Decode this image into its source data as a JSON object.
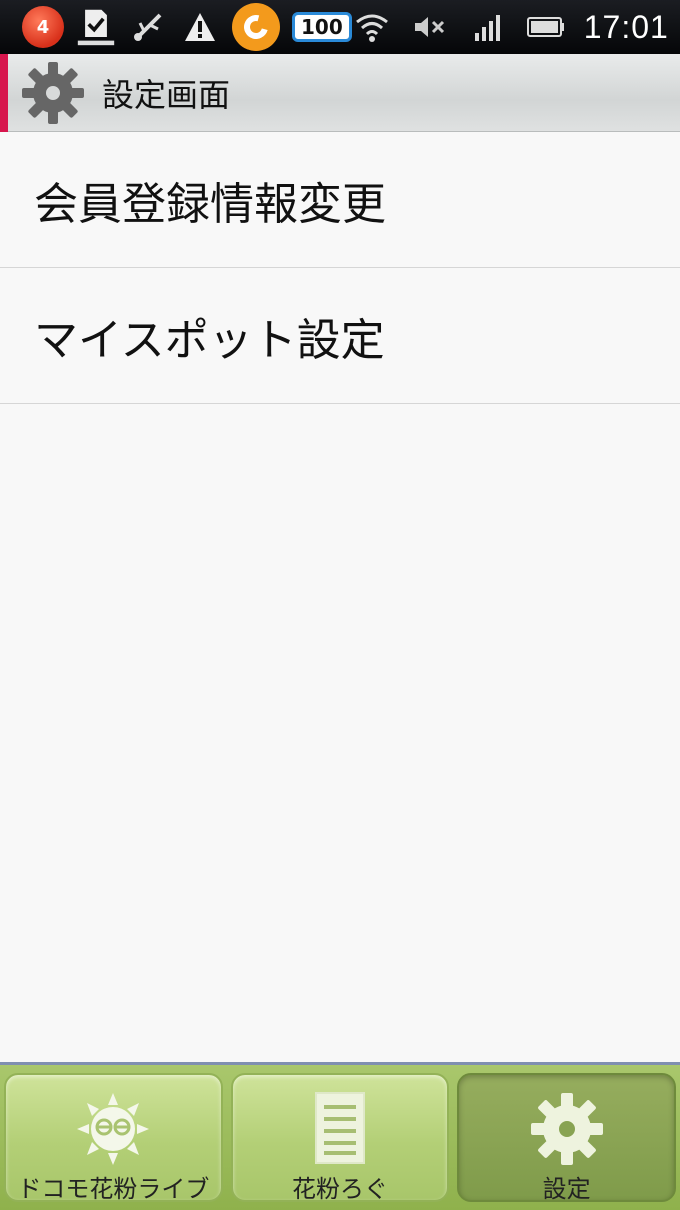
{
  "status_bar": {
    "notification_count": "4",
    "battery_level": "100",
    "time": "17:01",
    "icons": [
      "notification-bubble-icon",
      "download-complete-icon",
      "usb-icon",
      "warning-icon",
      "orange-app-icon",
      "battery-badge-icon",
      "wifi-icon",
      "mute-icon",
      "signal-icon",
      "battery-icon"
    ]
  },
  "header": {
    "title": "設定画面",
    "icon": "gear-icon",
    "accent_color": "#d7164d"
  },
  "menu": {
    "items": [
      {
        "label": "会員登録情報変更"
      },
      {
        "label": "マイスポット設定"
      }
    ]
  },
  "tabs": [
    {
      "label": "ドコモ花粉ライブ",
      "icon": "sun-face-icon",
      "active": false
    },
    {
      "label": "花粉ろぐ",
      "icon": "document-list-icon",
      "active": false
    },
    {
      "label": "設定",
      "icon": "gear-icon",
      "active": true
    }
  ]
}
